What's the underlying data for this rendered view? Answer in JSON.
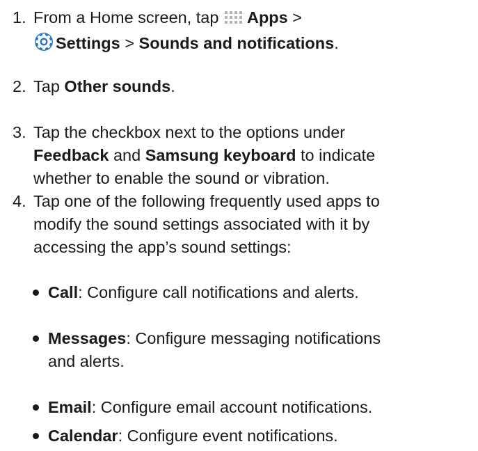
{
  "steps": [
    {
      "num": "1.",
      "l1_pre": "From a Home screen, tap",
      "apps_icon": "apps-grid-icon",
      "apps": "Apps",
      "sep1": " >",
      "settings_icon": "settings-gear-icon",
      "settings": "Settings",
      "sep2": " > ",
      "sounds": "Sounds and notifications",
      "end": "."
    },
    {
      "num": "2.",
      "pre": "Tap ",
      "bold": "Other sounds",
      "end": "."
    },
    {
      "num": "3.",
      "l1": "Tap the checkbox next to the options under",
      "b1": "Feedback",
      "mid": " and ",
      "b2": "Samsung keyboard",
      "rest": " to indicate",
      "l3": "whether to enable the sound or vibration."
    },
    {
      "num": "4.",
      "l1": "Tap one of the following frequently used apps to",
      "l2": "modify the sound settings associated with it by",
      "l3": "accessing the app’s sound settings:"
    }
  ],
  "bullets": [
    {
      "term": "Call",
      "desc": ": Configure call notifications and alerts."
    },
    {
      "term": "Messages",
      "desc": ": Configure messaging notifications",
      "desc2": "and alerts."
    },
    {
      "term": "Email",
      "desc": ": Configure email account notifications."
    },
    {
      "term": "Calendar",
      "desc": ": Configure event notifications."
    }
  ],
  "colors": {
    "text": "#1a1a1a",
    "icon_blue": "#2b78c2",
    "apps_grid": "#b3b3b3"
  }
}
